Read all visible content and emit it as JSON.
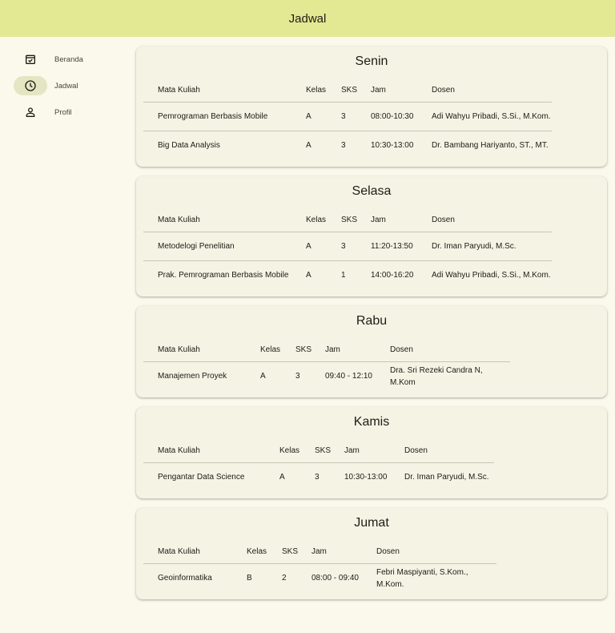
{
  "app_title": "Jadwal",
  "nav": [
    {
      "label": "Beranda",
      "icon": "calendar-check-icon",
      "active": false
    },
    {
      "label": "Jadwal",
      "icon": "clock-icon",
      "active": true
    },
    {
      "label": "Profil",
      "icon": "person-icon",
      "active": false
    }
  ],
  "headers": {
    "matkul": "Mata Kuliah",
    "kelas": "Kelas",
    "sks": "SKS",
    "jam": "Jam",
    "dosen": "Dosen"
  },
  "days": [
    {
      "name": "Senin",
      "rows": [
        {
          "matkul": "Pemrograman Berbasis Mobile",
          "kelas": "A",
          "sks": "3",
          "jam": "08:00-10:30",
          "dosen": "Adi Wahyu Pribadi, S.Si., M.Kom."
        },
        {
          "matkul": "Big Data Analysis",
          "kelas": "A",
          "sks": "3",
          "jam": "10:30-13:00",
          "dosen": "Dr. Bambang Hariyanto, ST., MT."
        }
      ]
    },
    {
      "name": "Selasa",
      "rows": [
        {
          "matkul": "Metodelogi Penelitian",
          "kelas": "A",
          "sks": "3",
          "jam": "11:20-13:50",
          "dosen": "Dr. Iman Paryudi, M.Sc."
        },
        {
          "matkul": "Prak. Pemrograman Berbasis Mobile",
          "kelas": "A",
          "sks": "1",
          "jam": "14:00-16:20",
          "dosen": "Adi Wahyu Pribadi, S.Si., M.Kom."
        }
      ]
    },
    {
      "name": "Rabu",
      "rows": [
        {
          "matkul": "Manajemen Proyek",
          "kelas": "A",
          "sks": "3",
          "jam": "09:40 - 12:10",
          "dosen": "Dra. Sri Rezeki Candra N, M.Kom"
        }
      ]
    },
    {
      "name": "Kamis",
      "rows": [
        {
          "matkul": "Pengantar Data Science",
          "kelas": "A",
          "sks": "3",
          "jam": "10:30-13:00",
          "dosen": "Dr. Iman Paryudi, M.Sc."
        }
      ]
    },
    {
      "name": "Jumat",
      "rows": [
        {
          "matkul": "Geoinformatika",
          "kelas": "B",
          "sks": "2",
          "jam": "08:00 - 09:40",
          "dosen": "Febri Maspiyanti, S.Kom., M.Kom."
        }
      ]
    }
  ]
}
